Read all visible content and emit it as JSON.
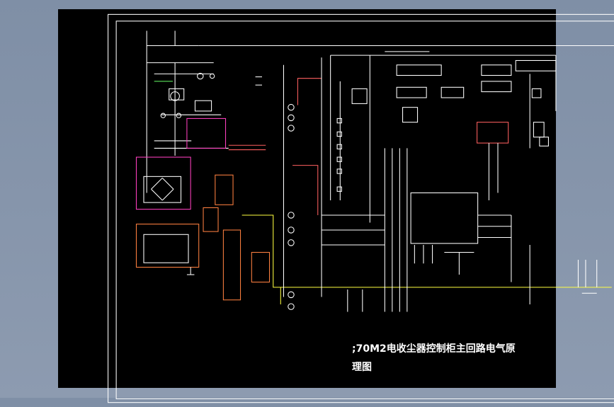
{
  "drawing": {
    "title_line1": ";70M2电收尘器控制柜主回路电气原",
    "title_line2": "理图"
  },
  "colors": {
    "background": "#8a98ae",
    "sheet": "#000000",
    "line": "#ffffff",
    "wire_red": "#ff6060",
    "box_magenta": "#ff40c0",
    "box_orange": "#ff8040",
    "wire_yellow": "#ffff40"
  }
}
